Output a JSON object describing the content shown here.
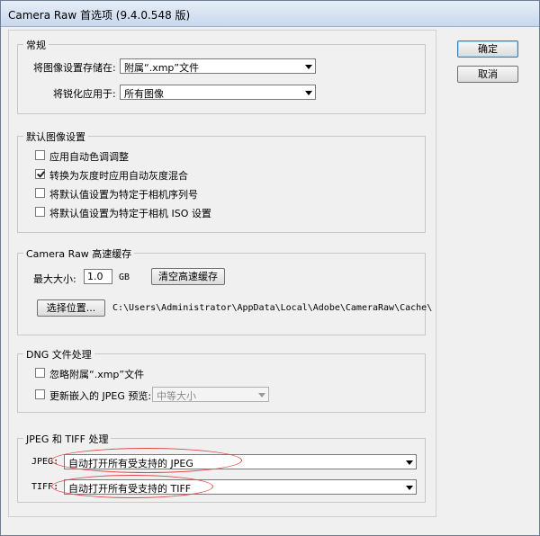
{
  "window": {
    "title": "Camera Raw 首选项 (9.4.0.548 版)"
  },
  "buttons": {
    "ok": "确定",
    "cancel": "取消"
  },
  "general": {
    "legend": "常规",
    "save_label": "将图像设置存储在:",
    "save_value": "附属“.xmp”文件",
    "sharpen_label": "将锐化应用于:",
    "sharpen_value": "所有图像"
  },
  "defaults": {
    "legend": "默认图像设置",
    "items": [
      {
        "label": "应用自动色调调整",
        "checked": false
      },
      {
        "label": "转换为灰度时应用自动灰度混合",
        "checked": true
      },
      {
        "label": "将默认值设置为特定于相机序列号",
        "checked": false
      },
      {
        "label": "将默认值设置为特定于相机 ISO 设置",
        "checked": false
      }
    ]
  },
  "cache": {
    "legend": "Camera Raw 高速缓存",
    "max_size_label": "最大大小:",
    "max_size_value": "1.0",
    "unit": "GB",
    "purge_button": "清空高速缓存",
    "select_button": "选择位置...",
    "path": "C:\\Users\\Administrator\\AppData\\Local\\Adobe\\CameraRaw\\Cache\\"
  },
  "dng": {
    "legend": "DNG 文件处理",
    "ignore_label": "忽略附属“.xmp”文件",
    "ignore_checked": false,
    "embed_label": "更新嵌入的 JPEG 预览:",
    "embed_checked": false,
    "embed_value": "中等大小"
  },
  "jpegtiff": {
    "legend": "JPEG 和 TIFF 处理",
    "jpeg_label": "JPEG:",
    "jpeg_value": "自动打开所有受支持的 JPEG",
    "tiff_label": "TIFF:",
    "tiff_value": "自动打开所有受支持的 TIFF"
  },
  "colors": {
    "highlight_ellipse": "#e04848",
    "default_button_border": "#3c7fb1"
  }
}
